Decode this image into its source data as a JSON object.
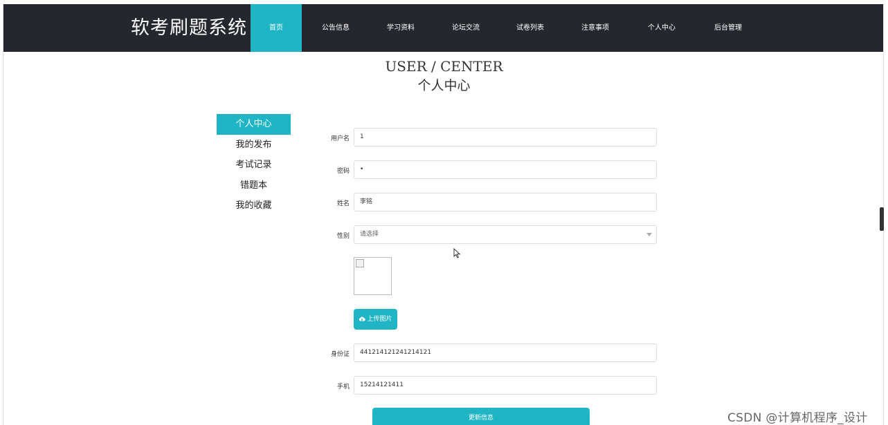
{
  "brand": "软考刷题系统",
  "nav": [
    {
      "label": "首页",
      "active": true
    },
    {
      "label": "公告信息"
    },
    {
      "label": "学习资料"
    },
    {
      "label": "论坛交流"
    },
    {
      "label": "试卷列表"
    },
    {
      "label": "注意事项"
    },
    {
      "label": "个人中心"
    },
    {
      "label": "后台管理"
    }
  ],
  "heading": {
    "en": "USER / CENTER",
    "cn": "个人中心"
  },
  "sidebar": {
    "items": [
      {
        "label": "个人中心",
        "active": true
      },
      {
        "label": "我的发布"
      },
      {
        "label": "考试记录"
      },
      {
        "label": "错题本"
      },
      {
        "label": "我的收藏"
      }
    ]
  },
  "form": {
    "username": {
      "label": "用户名",
      "value": "1"
    },
    "password": {
      "label": "密码",
      "value": "•"
    },
    "name": {
      "label": "姓名",
      "value": "李铭"
    },
    "gender": {
      "label": "性别",
      "placeholder": "请选择"
    },
    "upload_label": "上传图片",
    "idcard": {
      "label": "身份证",
      "value": "441214121241214121"
    },
    "phone": {
      "label": "手机",
      "value": "15214121411"
    },
    "submit_label": "更新信息"
  },
  "watermark": "CSDN @计算机程序_设计",
  "colors": {
    "accent": "#1fb5c4",
    "navbar": "#25272e"
  }
}
